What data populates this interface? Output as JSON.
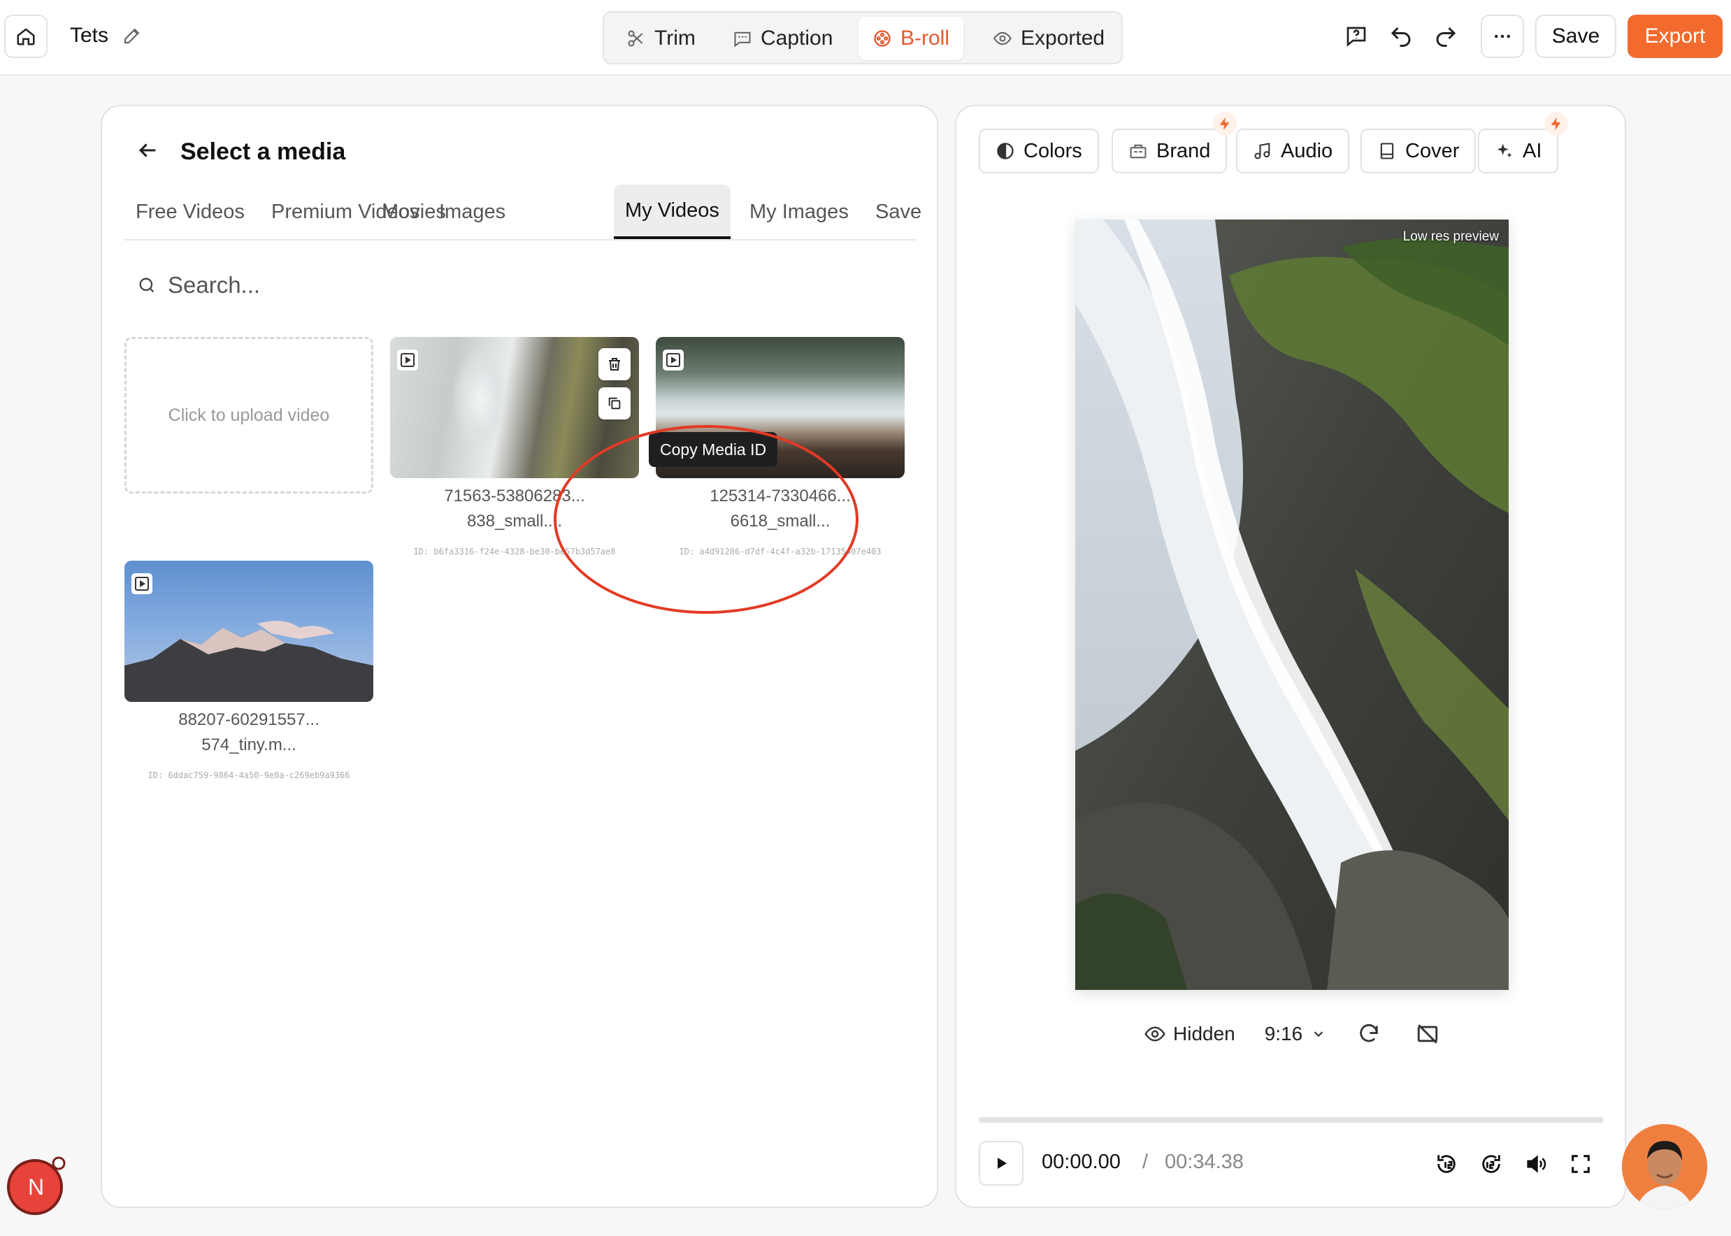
{
  "header": {
    "project_title": "Tets",
    "modes": [
      {
        "label": "Trim",
        "icon": "scissors-icon"
      },
      {
        "label": "Caption",
        "icon": "caption-icon"
      },
      {
        "label": "B-roll",
        "icon": "film-reel-icon",
        "active": true
      },
      {
        "label": "Exported",
        "icon": "eye-icon"
      }
    ],
    "save_label": "Save",
    "export_label": "Export",
    "accent_color": "#f26a2e"
  },
  "media_panel": {
    "title": "Select a media",
    "tabs": [
      "Free Videos",
      "Premium Videos",
      "Movies",
      "Images",
      "My Videos",
      "My Images",
      "Save"
    ],
    "active_tab": "My Videos",
    "search_placeholder": "Search...",
    "upload_label": "Click to upload video",
    "tooltip": "Copy Media ID",
    "items": [
      {
        "name_line1": "71563-53806283...",
        "name_line2": "838_small....",
        "id": "ID: b6fa3316-f24e-4328-be30-be57b3d57ae8"
      },
      {
        "name_line1": "125314-7330466...",
        "name_line2": "6618_small...",
        "id": "ID: a4d91286-d7df-4c4f-a32b-17135407e403"
      },
      {
        "name_line1": "88207-60291557...",
        "name_line2": "574_tiny.m...",
        "id": "ID: 6ddac759-9864-4a50-9e0a-c269eb9a9366"
      }
    ]
  },
  "preview_panel": {
    "tools": [
      {
        "label": "Colors",
        "icon": "contrast-icon"
      },
      {
        "label": "Brand",
        "icon": "brand-kit-icon",
        "premium": true
      },
      {
        "label": "Audio",
        "icon": "music-note-icon"
      },
      {
        "label": "Cover",
        "icon": "cover-icon"
      },
      {
        "label": "AI",
        "icon": "sparkles-icon",
        "premium": true
      }
    ],
    "preview_badge": "Low res preview",
    "visibility_label": "Hidden",
    "aspect_ratio": "9:16",
    "current_time": "00:00.00",
    "time_separator": "/",
    "total_time": "00:34.38",
    "progress": 0
  },
  "floating": {
    "notification_avatar_letter": "N"
  }
}
